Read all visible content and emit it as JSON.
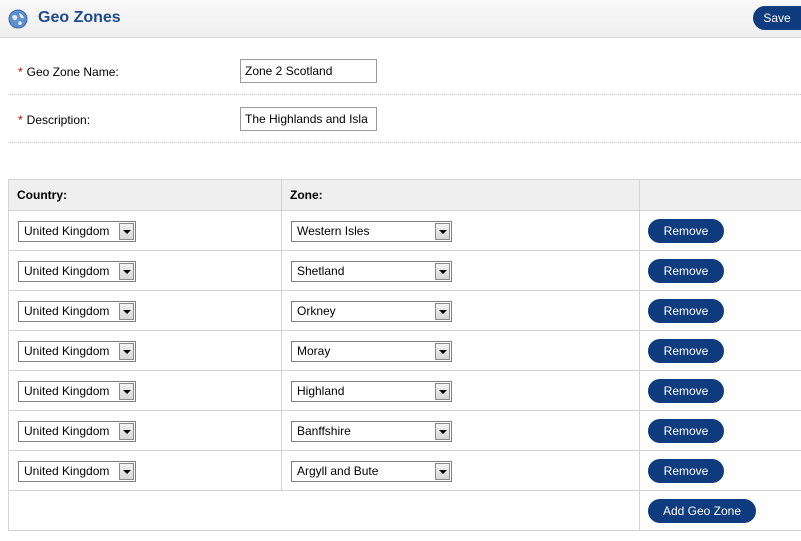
{
  "header": {
    "title": "Geo Zones",
    "save_label": "Save",
    "icon": "globe-icon"
  },
  "form": {
    "name_label": "Geo Zone Name:",
    "name_value": "Zone 2 Scotland",
    "description_label": "Description:",
    "description_value": "The Highlands and Isla",
    "required_marker": "*"
  },
  "table": {
    "headers": [
      "Country:",
      "Zone:",
      ""
    ],
    "rows": [
      {
        "country": "United Kingdom",
        "zone": "Western Isles",
        "action": "Remove"
      },
      {
        "country": "United Kingdom",
        "zone": "Shetland",
        "action": "Remove"
      },
      {
        "country": "United Kingdom",
        "zone": "Orkney",
        "action": "Remove"
      },
      {
        "country": "United Kingdom",
        "zone": "Moray",
        "action": "Remove"
      },
      {
        "country": "United Kingdom",
        "zone": "Highland",
        "action": "Remove"
      },
      {
        "country": "United Kingdom",
        "zone": "Banffshire",
        "action": "Remove"
      },
      {
        "country": "United Kingdom",
        "zone": "Argyll and Bute",
        "action": "Remove"
      }
    ],
    "add_label": "Add Geo Zone"
  },
  "colors": {
    "accent": "#0e3c7e",
    "title": "#1e4b8c",
    "required": "#d00000"
  }
}
